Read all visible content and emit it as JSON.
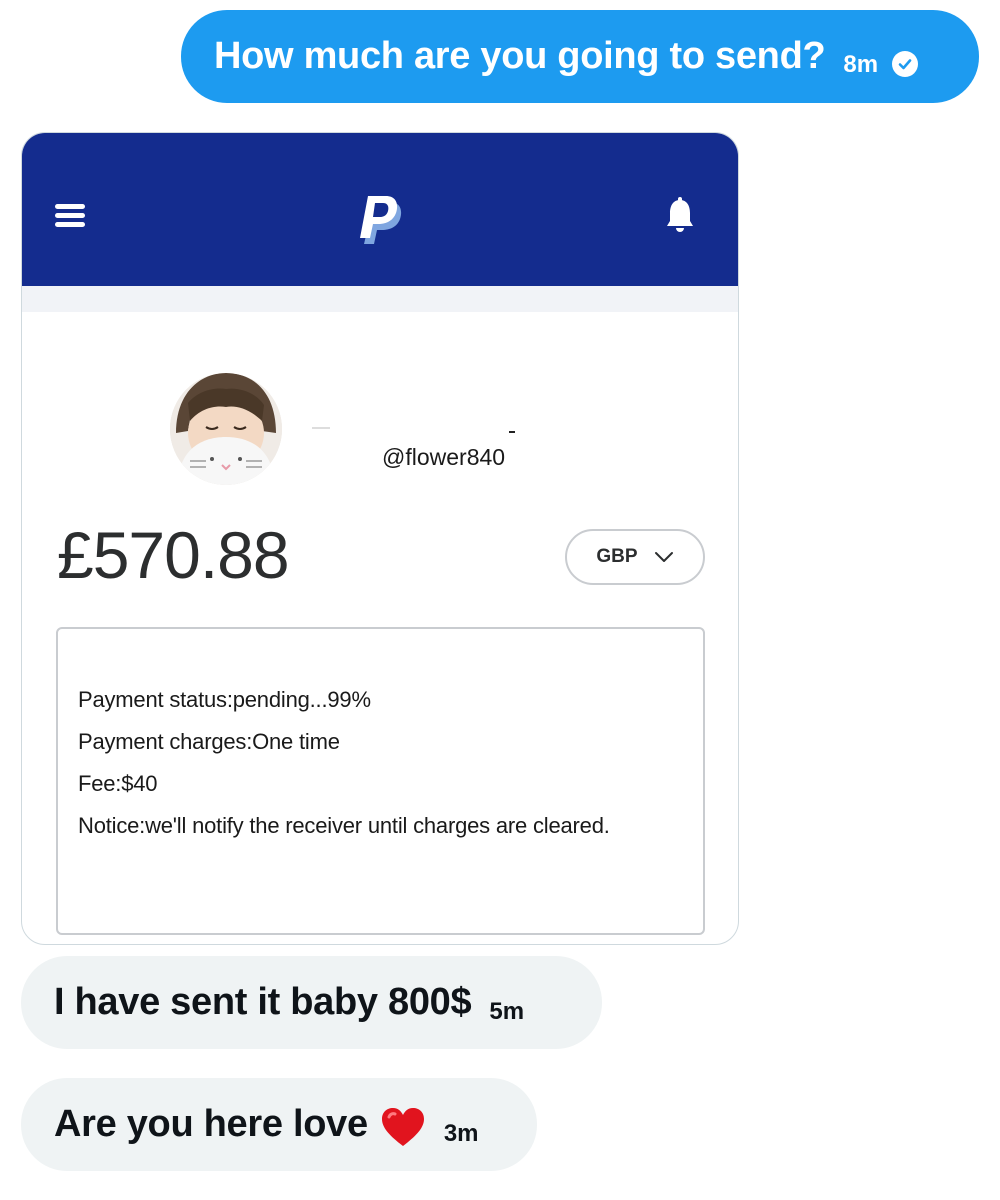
{
  "outgoing": {
    "text": "How much are you going to send?",
    "time": "8m",
    "status_icon": "sent-check-icon"
  },
  "paypal": {
    "header_icons": [
      "menu-icon",
      "paypal-logo",
      "bell-icon"
    ],
    "brand_color": "#142c8e",
    "handle": "@flower840",
    "amount": "£570.88",
    "currency": "GBP",
    "status_lines": [
      "Payment status:pending...99%",
      "Payment charges:One time",
      "Fee:$40",
      "Notice:we'll notify the receiver until charges are cleared."
    ]
  },
  "incoming": [
    {
      "text": "I have sent it baby 800$",
      "time": "5m"
    },
    {
      "text": "Are you here love",
      "time": "3m",
      "emoji": "heart-icon"
    }
  ],
  "colors": {
    "outgoing_bubble": "#1d9bf0",
    "incoming_bubble": "#eff3f4"
  }
}
